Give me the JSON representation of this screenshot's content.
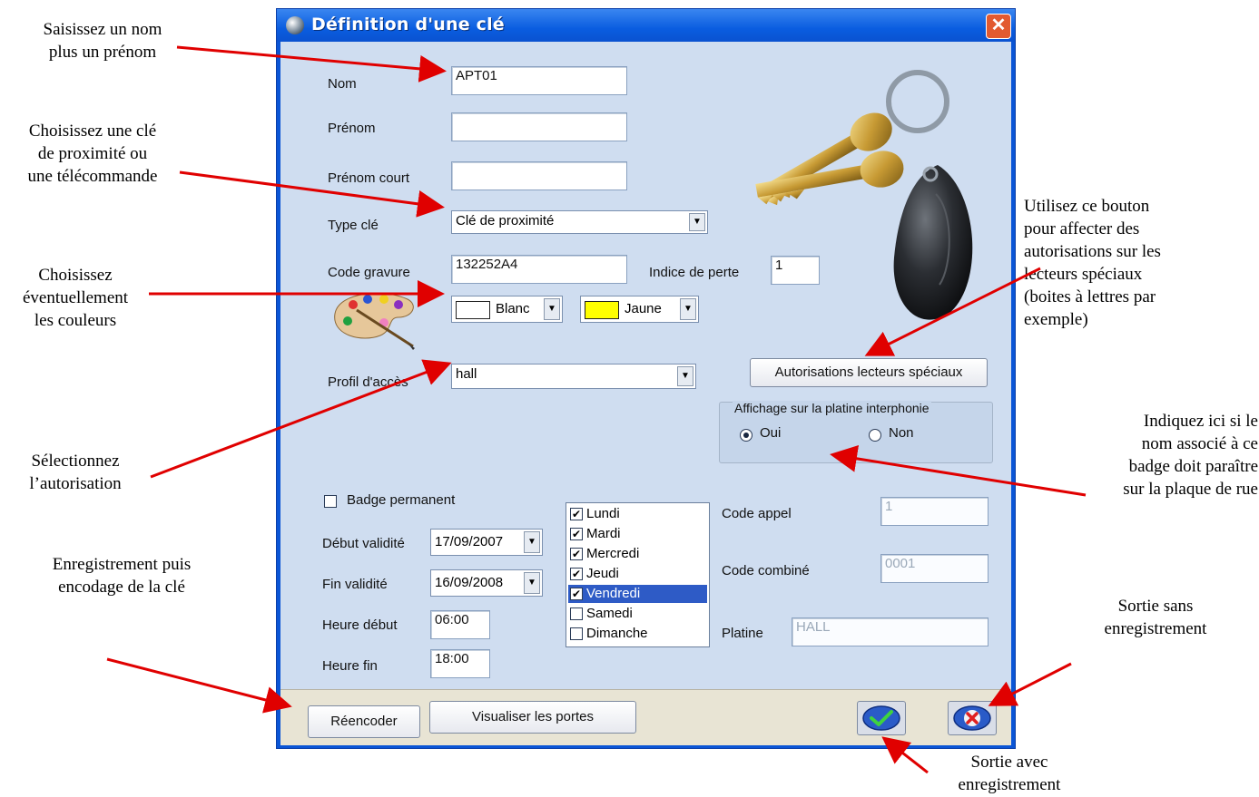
{
  "annotations": {
    "nom": [
      "Saisissez un nom",
      "plus un prénom"
    ],
    "type_cle": [
      "Choisissez une clé",
      "de proximité ou",
      "une télécommande"
    ],
    "couleurs": [
      "Choisissez",
      "éventuellement",
      "les couleurs"
    ],
    "autorisation": [
      "Sélectionnez",
      "l’autorisation"
    ],
    "enregistrement": [
      "Enregistrement puis",
      "encodage de la clé"
    ],
    "bouton_speciaux": [
      "Utilisez ce bouton",
      "pour affecter des",
      "autorisations  sur les",
      "lecteurs spéciaux",
      "(boites à lettres par",
      "exemple)"
    ],
    "platine": [
      "Indiquez ici si le",
      "nom associé à ce",
      "badge doit paraître",
      "sur la plaque de rue"
    ],
    "sortie_sans": [
      "Sortie sans",
      "enregistrement"
    ],
    "sortie_avec": [
      "Sortie avec",
      "enregistrement"
    ]
  },
  "window": {
    "title": "Définition d'une clé",
    "close_glyph": "✕"
  },
  "form": {
    "nom": {
      "label": "Nom",
      "value": "APT01"
    },
    "prenom": {
      "label": "Prénom",
      "value": ""
    },
    "prenom_court": {
      "label": "Prénom court",
      "value": ""
    },
    "type_cle": {
      "label": "Type clé",
      "value": "Clé de proximité"
    },
    "code_gravure": {
      "label": "Code gravure",
      "value": "132252A4"
    },
    "indice_perte": {
      "label": "Indice de perte",
      "value": "1"
    },
    "couleur1": {
      "value": "Blanc",
      "swatch": "#ffffff"
    },
    "couleur2": {
      "value": "Jaune",
      "swatch": "#ffff00"
    },
    "profil_acces": {
      "label": "Profil d'accès",
      "value": "hall"
    },
    "badge_permanent": {
      "label": "Badge permanent",
      "checked": false
    },
    "debut_validite": {
      "label": "Début validité",
      "value": "17/09/2007"
    },
    "fin_validite": {
      "label": "Fin validité",
      "value": "16/09/2008"
    },
    "heure_debut": {
      "label": "Heure début",
      "value": "06:00"
    },
    "heure_fin": {
      "label": "Heure fin",
      "value": "18:00"
    },
    "days": [
      {
        "label": "Lundi",
        "checked": true
      },
      {
        "label": "Mardi",
        "checked": true
      },
      {
        "label": "Mercredi",
        "checked": true
      },
      {
        "label": "Jeudi",
        "checked": true
      },
      {
        "label": "Vendredi",
        "checked": true,
        "selected": true
      },
      {
        "label": "Samedi",
        "checked": false
      },
      {
        "label": "Dimanche",
        "checked": false
      }
    ],
    "code_appel": {
      "label": "Code appel",
      "value": "1"
    },
    "code_combine": {
      "label": "Code combiné",
      "value": "0001"
    },
    "platine": {
      "label": "Platine",
      "value": "HALL"
    },
    "autorisations_button": "Autorisations lecteurs spéciaux",
    "affichage": {
      "title": "Affichage sur la platine interphonie",
      "oui": "Oui",
      "non": "Non",
      "selected": "Oui"
    },
    "check_glyph": "✔"
  },
  "bottom": {
    "reencoder": "Réencoder",
    "visualiser": "Visualiser les portes"
  },
  "colors": {
    "titlebar": "#0a5de0",
    "client": "#cfddf0",
    "arrow": "#e00000",
    "selection": "#2e5bc6"
  }
}
